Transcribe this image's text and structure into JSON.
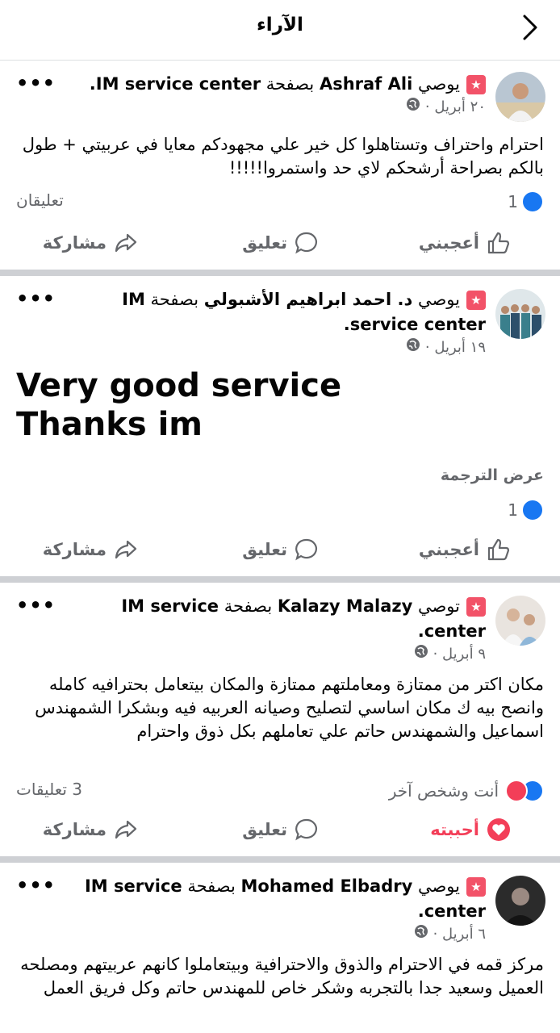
{
  "header": {
    "title": "الآراء"
  },
  "posts": [
    {
      "recommend_word": "يوصي",
      "author": "Ashraf Ali",
      "page_word": "بصفحة",
      "page_name": "IM service center.",
      "date": "٢٠ أبريل ·",
      "body": "احترام واحتراف وتستاهلوا كل خير علي مجهودكم معايا في عربيتي + طول بالكم بصراحة أرشحكم لاي حد واستمروا!!!!!",
      "reaction_count": "1",
      "comments_label": "تعليقان",
      "like_label": "أعجبني",
      "comment_label": "تعليق",
      "share_label": "مشاركة"
    },
    {
      "recommend_word": "يوصي",
      "author": "د. احمد ابراهيم الأشبولي",
      "page_word": "بصفحة",
      "page_name": "IM service center.",
      "date": "١٩ أبريل ·",
      "body_line1": "Very good service",
      "body_line2": "Thanks im",
      "translate_label": "عرض الترجمة",
      "reaction_count": "1",
      "like_label": "أعجبني",
      "comment_label": "تعليق",
      "share_label": "مشاركة"
    },
    {
      "recommend_word": "توصي",
      "author": "Kalazy Malazy",
      "page_word": "بصفحة",
      "page_name": "IM service center.",
      "date": "٩ أبريل ·",
      "body": "مكان اكتر من ممتازة ومعاملتهم ممتازة والمكان بيتعامل بحترافيه كامله وانصح بيه ك مكان اساسي لتصليح وصيانه العربيه فيه وبشكرا الشمهندس اسماعيل والشمهندس حاتم علي تعاملهم بكل ذوق واحترام",
      "reactions_label": "أنت وشخص آخر",
      "comments_label": "3 تعليقات",
      "like_label": "أحببته",
      "comment_label": "تعليق",
      "share_label": "مشاركة"
    },
    {
      "recommend_word": "يوصي",
      "author": "Mohamed Elbadry",
      "page_word": "بصفحة",
      "page_name": "IM service center.",
      "date": "٦ أبريل ·",
      "body": "مركز قمه في الاحترام والذوق والاحترافية وبيتعاملوا كانهم عربيتهم ومصلحه العميل وسعيد جدا بالتجربه وشكر خاص للمهندس حاتم وكل فريق العمل"
    }
  ],
  "colors": {
    "like_blue": "#1877f2",
    "love_red": "#f33e58",
    "recommend_badge": "#f25268",
    "separator": "#ced0d4"
  }
}
